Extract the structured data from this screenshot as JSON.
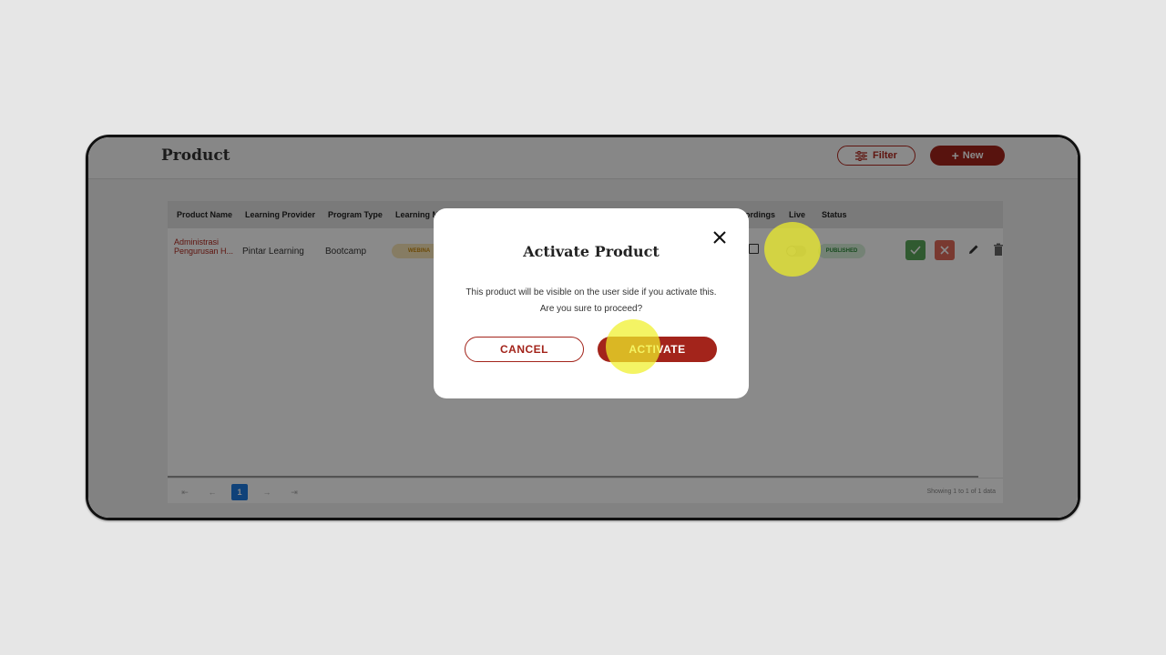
{
  "page": {
    "title": "Product"
  },
  "toolbar": {
    "filter_label": "Filter",
    "new_label": "New"
  },
  "table": {
    "columns": [
      "Product Name",
      "Learning Provider",
      "Program Type",
      "Learning M",
      "ordings",
      "Live",
      "Status"
    ],
    "rows": [
      {
        "product_name": "Administrasi Pengurusan H...",
        "learning_provider": "Pintar Learning",
        "program_type": "Bootcamp",
        "learning_method": "WEBINA",
        "status": "PUBLISHED"
      }
    ]
  },
  "pagination": {
    "current_page": "1",
    "showing": "Showing 1 to 1 of 1 data"
  },
  "modal": {
    "title": "Activate Product",
    "body": "This product will be visible on the user side if you activate this. Are you sure to proceed?",
    "cancel_label": "CANCEL",
    "activate_label": "ACTIVATE"
  },
  "colors": {
    "brand": "#a3241b",
    "highlight": "#f0f028",
    "pager_active": "#1f7ae0",
    "published_badge": "#d6f0d8",
    "webinar_badge": "#f8e6b8"
  },
  "icons": [
    "filter-icon",
    "plus-icon",
    "close-icon",
    "check-icon",
    "x-icon",
    "pencil-icon",
    "trash-icon",
    "recording-icon",
    "first-page-icon",
    "prev-page-icon",
    "next-page-icon",
    "last-page-icon"
  ]
}
